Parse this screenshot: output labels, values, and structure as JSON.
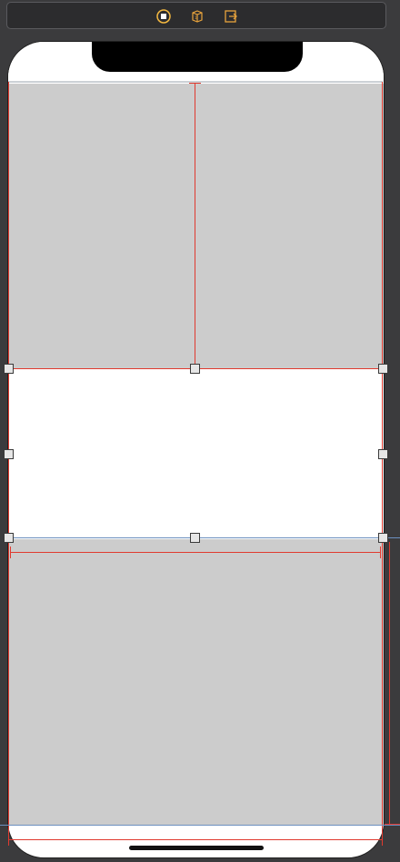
{
  "scene_dock": {
    "icons": [
      {
        "name": "view-controller-icon",
        "color": "#f5b940"
      },
      {
        "name": "first-responder-icon",
        "color": "#e8a33c"
      },
      {
        "name": "exit-icon",
        "color": "#e8a33c"
      }
    ]
  },
  "colors": {
    "canvas": "#3b3b3d",
    "placeholder_gray": "#cccccc",
    "constraint_red": "#e03a2f",
    "guide_blue": "#6b8fbf"
  },
  "selection": {
    "selected_view": "middle-white-view"
  }
}
